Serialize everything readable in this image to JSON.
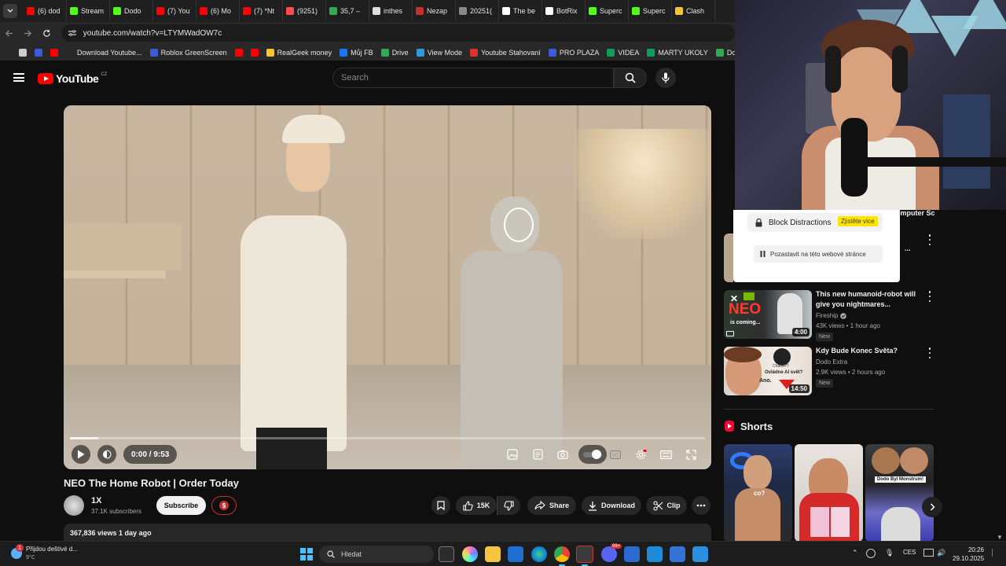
{
  "browser": {
    "tabs": [
      {
        "label": "(6) dod",
        "color": "#ff0000"
      },
      {
        "label": "Stream",
        "color": "#53fc18"
      },
      {
        "label": "Dodo",
        "color": "#53fc18"
      },
      {
        "label": "(7) You",
        "color": "#ff0000"
      },
      {
        "label": "(6) Mo",
        "color": "#ff0000"
      },
      {
        "label": "(7) *Nt",
        "color": "#ff0000"
      },
      {
        "label": "(9251)",
        "color": "#ff4b4b"
      },
      {
        "label": "35,7 –",
        "color": "#34a853"
      },
      {
        "label": "inthes",
        "color": "#dddddd"
      },
      {
        "label": "Nezap",
        "color": "#c4302b"
      },
      {
        "label": "20251(",
        "color": "#888888"
      },
      {
        "label": "The be",
        "color": "#ffffff"
      },
      {
        "label": "BotRix",
        "color": "#ffffff"
      },
      {
        "label": "Superc",
        "color": "#53fc18"
      },
      {
        "label": "Superc",
        "color": "#53fc18"
      },
      {
        "label": "Clash",
        "color": "#f6c431"
      }
    ],
    "url": "youtube.com/watch?v=LTYMWadOW7c",
    "bookmarks": [
      {
        "label": "",
        "color": "#cccccc"
      },
      {
        "label": "",
        "color": "#3b5bdb"
      },
      {
        "label": "",
        "color": "#ff0000"
      },
      {
        "label": "Download Youtube...",
        "color": "#282828"
      },
      {
        "label": "Roblox GreenScreen",
        "color": "#3b5bdb"
      },
      {
        "label": "",
        "color": "#ff0000"
      },
      {
        "label": "",
        "color": "#ff0000"
      },
      {
        "label": "RealGeek money",
        "color": "#f6c431"
      },
      {
        "label": "Můj FB",
        "color": "#1877f2"
      },
      {
        "label": "Drive",
        "color": "#34a853"
      },
      {
        "label": "View Mode",
        "color": "#2e9cdb"
      },
      {
        "label": "Youtube Stahovaní",
        "color": "#e03131"
      },
      {
        "label": "PRO PLAZA",
        "color": "#3b5bdb"
      },
      {
        "label": "VIDEA",
        "color": "#0f9d58"
      },
      {
        "label": "MARTY UKOLY",
        "color": "#0f9d58"
      },
      {
        "label": "Dodo videa",
        "color": "#34a853"
      }
    ]
  },
  "youtube": {
    "logo_text": "YouTube",
    "country_code": "CZ",
    "search_placeholder": "Search"
  },
  "player": {
    "time": "0:00 / 9:53",
    "progress": 0.045
  },
  "video": {
    "title": "NEO The Home Robot | Order Today",
    "channel": "1X",
    "subscribers": "37.1K subscribers",
    "subscribe_label": "Subscribe",
    "join_symbol": "$",
    "likes": "15K",
    "share_label": "Share",
    "download_label": "Download",
    "clip_label": "Clip",
    "views_date": "367,836 views  1 day ago"
  },
  "sidebar": {
    "partial_title": "omputer Sc",
    "partial_ellipsis": "...",
    "videos": [
      {
        "title": "This new humanoid-robot will give you nightmares...",
        "channel": "Fireship",
        "meta": "43K views • 1 hour ago",
        "badge": "New",
        "duration": "4:00",
        "thumb_text": "NEO",
        "thumb_sub": "is coming..."
      },
      {
        "title": "Kdy Bude Konec Světa?",
        "channel": "Dodo Extra",
        "meta": "2.9K views • 2 hours ago",
        "badge": "New",
        "duration": "14:50",
        "thumb_text": "Ovládne AI svět?",
        "thumb_sub": "Ano.",
        "thumb_logo": "ChatGPT"
      }
    ],
    "shorts_label": "Shorts",
    "shorts": [
      {
        "overlay": "co?"
      },
      {
        "overlay": ""
      },
      {
        "overlay": "Dodo Byl Monstrum!"
      }
    ]
  },
  "extension_popup": {
    "title": "Block Distractions",
    "badge": "Zjistěte více",
    "pause_label": "Pozastavit na této webové stránce"
  },
  "taskbar": {
    "weather_text": "Přijdou deštivé d...",
    "weather_temp": "9°C",
    "weather_badge": "1",
    "search_placeholder": "Hledat",
    "language": "CES",
    "time": "20:26",
    "date": "29.10.2025",
    "discord_badge": "99+"
  }
}
